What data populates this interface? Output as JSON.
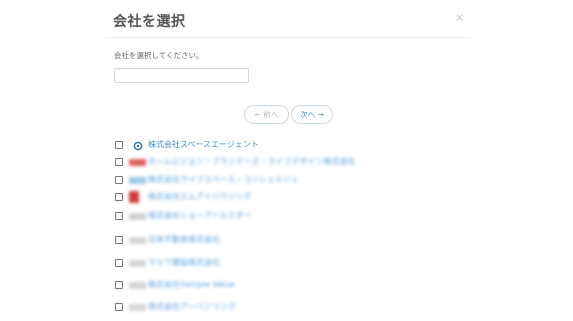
{
  "modal": {
    "title": "会社を選択",
    "close_glyph": "×",
    "instruction": "会社を選択してください。"
  },
  "search": {
    "value": "",
    "placeholder": ""
  },
  "pagination": {
    "prev_label": "← 前へ",
    "next_label": "次へ →"
  },
  "companies": [
    {
      "name": "株式会社スペースエージェント",
      "logo_color": "#2a6fb8",
      "checked": false
    },
    {
      "name": "ホームビジョン・プランナーズ・ライフデザイン株式会社",
      "logo_color": "#e06060",
      "checked": false
    },
    {
      "name": "株式会社ライフスペース・コンシェルジュ",
      "logo_color": "#9ccbe8",
      "checked": false
    },
    {
      "name": "株式会社エムアイハウジング",
      "logo_color": "#d04040",
      "checked": false
    },
    {
      "name": "株式会社ショーアールスター",
      "logo_color": "#cfcfcf",
      "checked": false
    },
    {
      "name": "日本不動産株式会社",
      "logo_color": "#d5d5d5",
      "checked": false
    },
    {
      "name": "マルワ建設株式会社",
      "logo_color": "#d5d5d5",
      "checked": false
    },
    {
      "name": "株式会社Sample Value",
      "logo_color": "#d5d5d5",
      "checked": false
    },
    {
      "name": "株式会社アーバンリンク",
      "logo_color": "#d5d5d5",
      "checked": false
    }
  ]
}
